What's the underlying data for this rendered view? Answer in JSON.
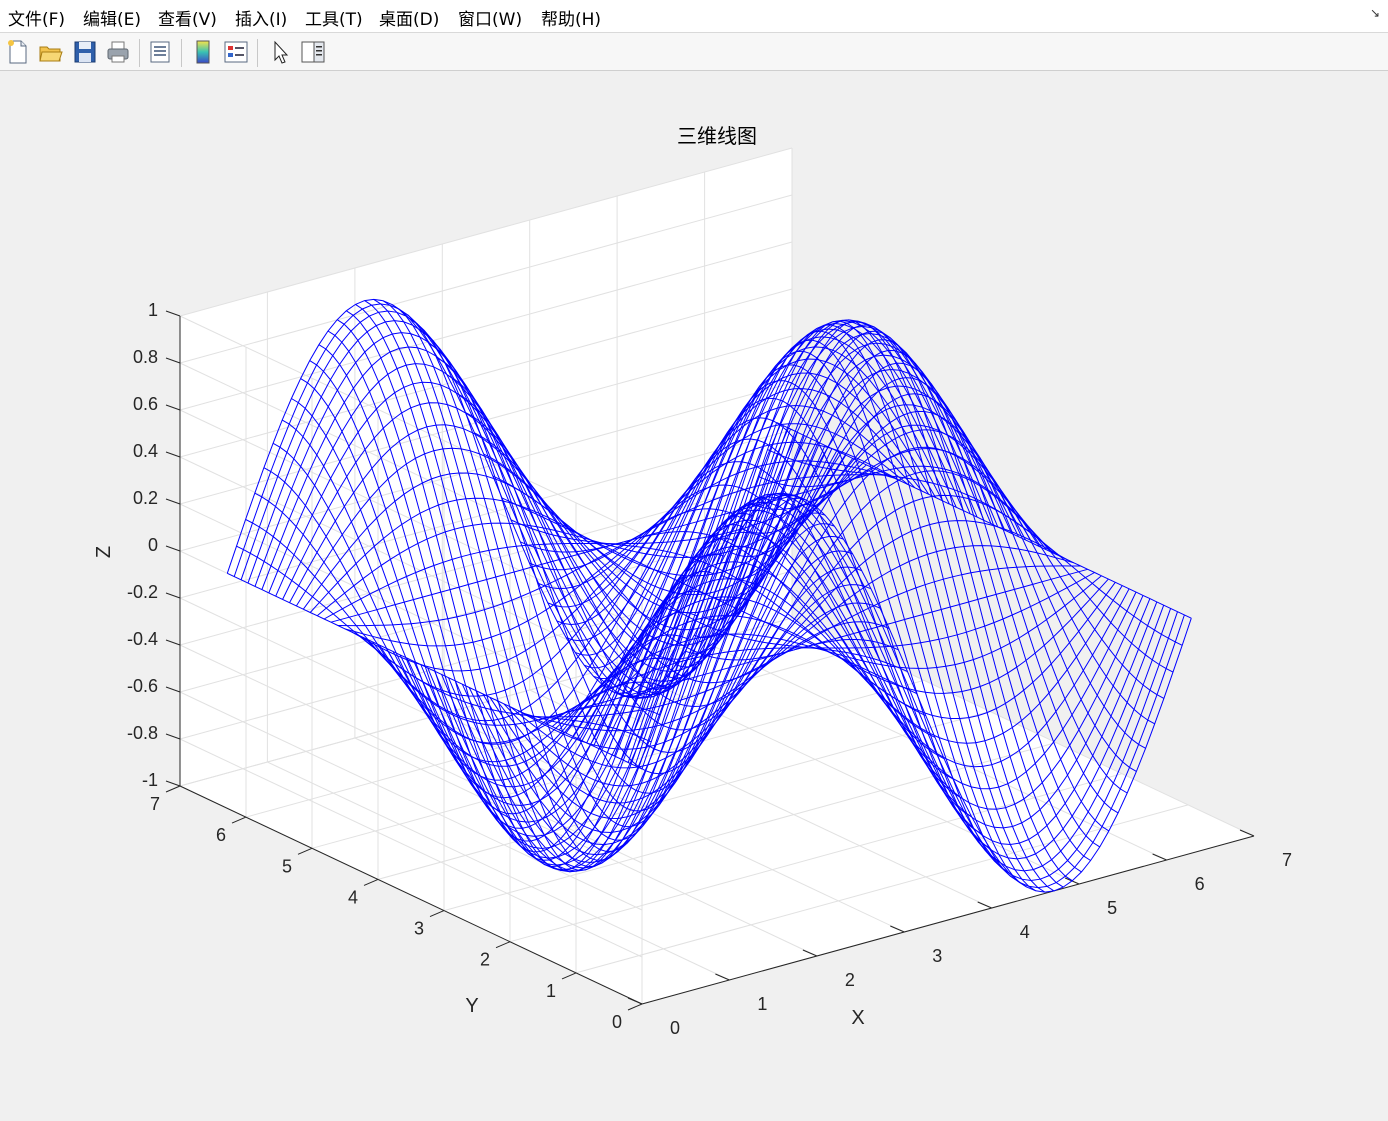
{
  "menu": {
    "file": "文件(F)",
    "edit": "编辑(E)",
    "view": "查看(V)",
    "insert": "插入(I)",
    "tools": "工具(T)",
    "desktop": "桌面(D)",
    "window": "窗口(W)",
    "help": "帮助(H)"
  },
  "toolbar": {
    "icons": [
      "new-figure-icon",
      "open-file-icon",
      "save-icon",
      "print-icon",
      "print-preview-icon",
      "colorbar-icon",
      "legend-icon",
      "select-arrow-icon",
      "property-editor-icon"
    ]
  },
  "colors": {
    "line": "#0000ff",
    "axis": "#262626",
    "grid": "#e1e1e1",
    "background": "#f0f0f0"
  },
  "chart_data": {
    "type": "line3d",
    "title": "三维线图",
    "xlabel": "X",
    "ylabel": "Y",
    "zlabel": "Z",
    "xlim": [
      0,
      7
    ],
    "ylim": [
      0,
      7
    ],
    "zlim": [
      -1,
      1
    ],
    "xticks": [
      "0",
      "1",
      "2",
      "3",
      "4",
      "5",
      "6",
      "7"
    ],
    "yticks": [
      "0",
      "1",
      "2",
      "3",
      "4",
      "5",
      "6",
      "7"
    ],
    "zticks": [
      "-1",
      "-0.8",
      "-0.6",
      "-0.4",
      "-0.2",
      "0",
      "0.2",
      "0.4",
      "0.6",
      "0.8",
      "1"
    ],
    "function": "z = sin(x)·cos(y)",
    "x_range": [
      0,
      6.2832
    ],
    "y_range": [
      0,
      6.2832
    ],
    "lines_along_x": 61,
    "lines_along_y": 61,
    "samples_per_line": 61,
    "grid": true,
    "line_color": "#0000ff"
  }
}
